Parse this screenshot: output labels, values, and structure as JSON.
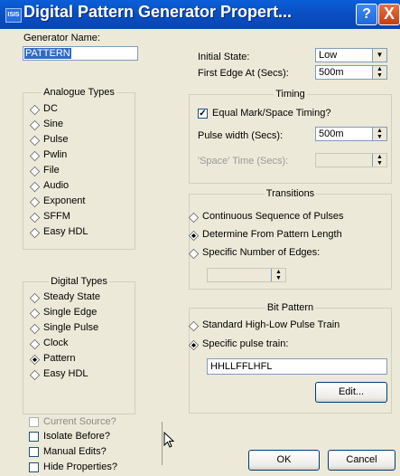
{
  "title": {
    "icon_text": "ISIS",
    "text": "Digital Pattern Generator Propert...",
    "help_label": "?",
    "close_label": "X"
  },
  "generator": {
    "name_label": "Generator Name:",
    "name_value": "PATTERN"
  },
  "analogue": {
    "title": "Analogue Types",
    "options": [
      "DC",
      "Sine",
      "Pulse",
      "Pwlin",
      "File",
      "Audio",
      "Exponent",
      "SFFM",
      "Easy HDL"
    ]
  },
  "digital": {
    "title": "Digital Types",
    "options": [
      "Steady State",
      "Single Edge",
      "Single Pulse",
      "Clock",
      "Pattern",
      "Easy HDL"
    ],
    "selected": "Pattern"
  },
  "options": {
    "current_source": "Current Source?",
    "isolate_before": "Isolate Before?",
    "manual_edits": "Manual Edits?",
    "hide_properties": "Hide Properties?"
  },
  "initial_state": {
    "label": "Initial State:",
    "value": "Low"
  },
  "first_edge": {
    "label": "First Edge At (Secs):",
    "value": "500m"
  },
  "timing": {
    "title": "Timing",
    "equal_mark_space": "Equal Mark/Space Timing?",
    "equal_mark_space_checked": true,
    "pulse_width_label": "Pulse width (Secs):",
    "pulse_width_value": "500m",
    "space_time_label": "'Space' Time (Secs):",
    "space_time_value": ""
  },
  "transitions": {
    "title": "Transitions",
    "options": [
      "Continuous Sequence of Pulses",
      "Determine From Pattern Length",
      "Specific Number of Edges:"
    ],
    "selected": "Determine From Pattern Length",
    "edges_value": ""
  },
  "bit_pattern": {
    "title": "Bit Pattern",
    "options": [
      "Standard High-Low Pulse Train",
      "Specific pulse train:"
    ],
    "selected": "Specific pulse train:",
    "pattern_value": "HHLLFFLHFL",
    "edit_label": "Edit..."
  },
  "buttons": {
    "ok": "OK",
    "cancel": "Cancel"
  },
  "colors": {
    "title_bar": "#0b4fc4",
    "dialog_bg": "#ece9d8",
    "selection_bg": "#316ac5"
  },
  "cursor_icon": "mouse-pointer-icon"
}
